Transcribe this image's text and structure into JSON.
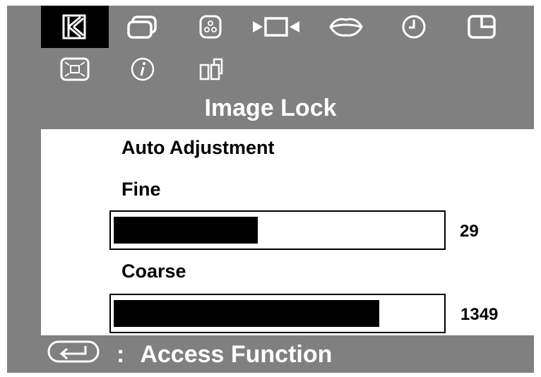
{
  "osd": {
    "title": "Image Lock",
    "menu_icons": [
      {
        "name": "image-lock-icon",
        "selected": true
      },
      {
        "name": "display-mode-icon",
        "selected": false
      },
      {
        "name": "color-icon",
        "selected": false
      },
      {
        "name": "position-icon",
        "selected": false
      },
      {
        "name": "sound-icon",
        "selected": false
      },
      {
        "name": "timer-icon",
        "selected": false
      },
      {
        "name": "window-icon",
        "selected": false
      },
      {
        "name": "zoom-icon",
        "selected": false
      },
      {
        "name": "information-icon",
        "selected": false
      },
      {
        "name": "copy-icon",
        "selected": false
      }
    ],
    "items": {
      "auto_adjustment": "Auto Adjustment",
      "fine": {
        "label": "Fine",
        "value": "29",
        "level": 0.44
      },
      "coarse": {
        "label": "Coarse",
        "value": "1349",
        "level": 0.81
      }
    },
    "footer": {
      "icon": "enter-icon",
      "colon": ":",
      "text": "Access Function"
    },
    "colors": {
      "background": "#808080",
      "panel": "#ffffff",
      "text_on_dark": "#ffffff",
      "selected": "#000000"
    }
  }
}
